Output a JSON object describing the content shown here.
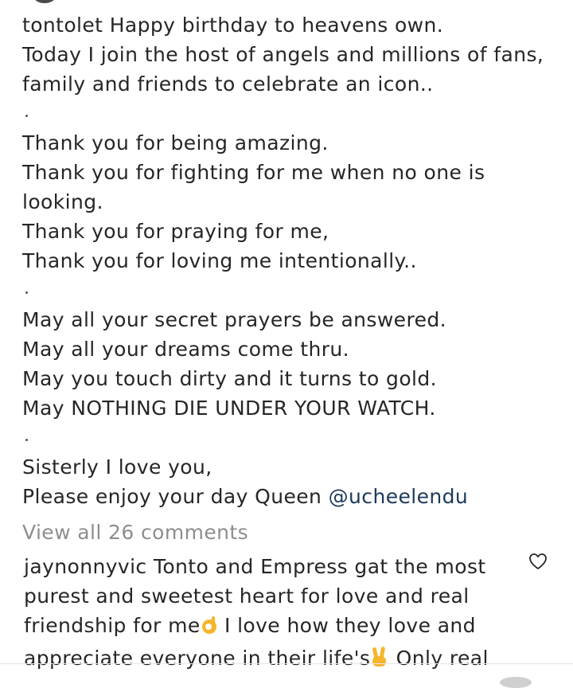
{
  "caption": {
    "lines": [
      "tontolet Happy birthday to heavens own.",
      "Today I join the host of angels and millions of fans,",
      "family and friends to celebrate an icon..",
      "",
      "Thank you for being amazing.",
      "Thank you for fighting for me when no one is",
      "looking.",
      "Thank you for praying for me,",
      "Thank you for loving me intentionally..",
      "",
      "May all your secret prayers be answered.",
      "May all your dreams come thru.",
      "May you touch dirty and it turns to gold.",
      "May NOTHING DIE UNDER YOUR WATCH.",
      "",
      "Sisterly I love you,"
    ],
    "last_line_prefix": "Please enjoy your day Queen ",
    "mention": "@ucheelendu"
  },
  "view_all_comments": "View all 26 comments",
  "comment": {
    "line1": "jaynonnyvic Tonto and Empress gat the most",
    "line2": "purest and sweetest heart for love and real",
    "line3_before": "friendship for me",
    "line3_after": " I love how they love and",
    "line4_before": "appreciate everyone in their life's",
    "line4_after": "  Only real",
    "emoji_1": "ok-hand-emoji",
    "emoji_2": "victory-hand-emoji"
  },
  "icons": {
    "like": "heart-icon"
  },
  "colors": {
    "text": "#262626",
    "muted": "#8e8e8e",
    "mention": "#1c3a5a",
    "emoji": "#f7b52c"
  }
}
